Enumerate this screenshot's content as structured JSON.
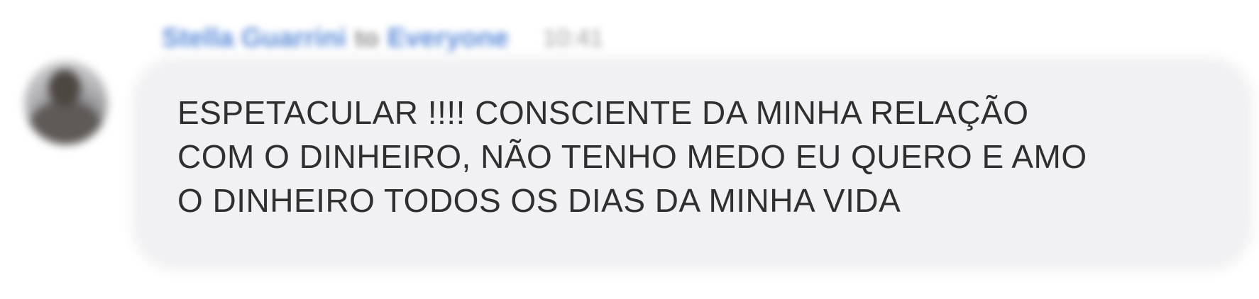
{
  "message": {
    "sender": "Stella Guarrini",
    "to_word": "to",
    "recipient": "Everyone",
    "timestamp": "10:41",
    "lines": [
      "ESPETACULAR !!!! CONSCIENTE DA MINHA RELAÇÃO",
      "COM O DINHEIRO, NÃO TENHO MEDO EU QUERO E AMO",
      "O DINHEIRO TODOS OS DIAS DA MINHA VIDA"
    ]
  },
  "colors": {
    "sender_name": "#5b8bd8",
    "bubble_background": "#f1f1f3",
    "message_text": "#2f2f30"
  },
  "icons": {
    "avatar": "user-avatar-photo"
  }
}
